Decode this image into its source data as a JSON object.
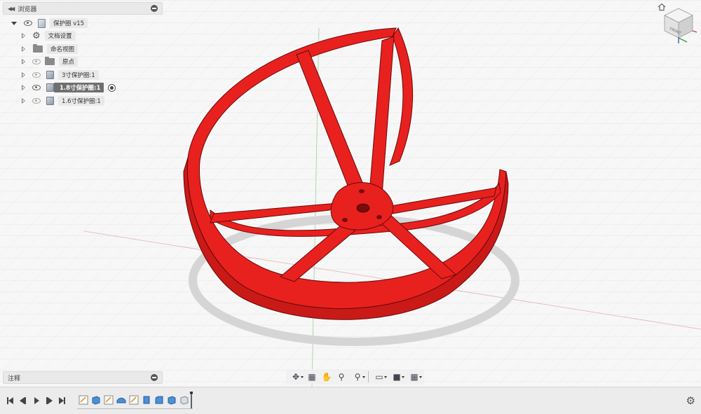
{
  "browser": {
    "title": "浏览器",
    "items": [
      {
        "label": "保护圈 v15",
        "icon": "document-icon"
      },
      {
        "label": "文档设置",
        "icon": "gear-icon"
      },
      {
        "label": "命名视图",
        "icon": "folder-icon"
      },
      {
        "label": "原点",
        "icon": "folder-icon"
      },
      {
        "label": "3寸保护圈:1",
        "icon": "body-icon"
      },
      {
        "label": "1.8寸保护圈:1",
        "icon": "body-icon",
        "selected": true
      },
      {
        "label": "1.6寸保护圈:1",
        "icon": "body-icon"
      }
    ]
  },
  "comments": {
    "title": "注释"
  },
  "viewcube": {
    "label": "FRONT"
  },
  "nav_toolbar": [
    "orbit-icon",
    "look-at-icon",
    "pan-icon",
    "zoom-icon",
    "fit-icon",
    "display-mode-icon",
    "visual-style-icon",
    "grid-icon"
  ],
  "timeline": {
    "controls": [
      "first-icon",
      "previous-icon",
      "play-icon",
      "next-icon",
      "last-icon"
    ],
    "feature_count": 9
  },
  "colors": {
    "model": "#e8211f",
    "model_edge": "#6b0808",
    "selected": "#6f6f6f"
  }
}
